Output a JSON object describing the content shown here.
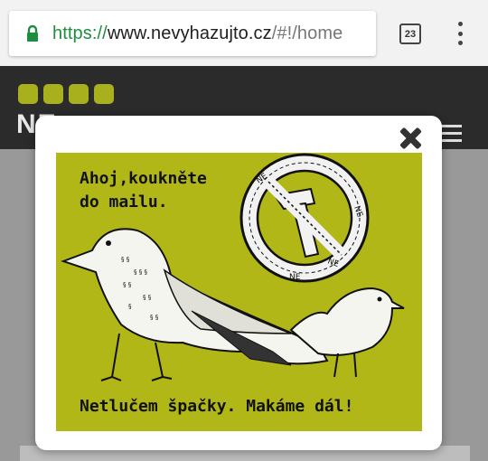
{
  "browser": {
    "url_scheme": "https://",
    "url_host": "www.nevyhazujto.cz",
    "url_path": "/#!/home",
    "tab_count": "23"
  },
  "site": {
    "logo_text": "NE"
  },
  "modal": {
    "line1": "Ahoj,koukněte",
    "line2": "do mailu.",
    "footer": "Netlučem špačky. Makáme dál!",
    "stamp_word": "NE"
  },
  "colors": {
    "promo_bg": "#b0b716",
    "header_bg": "#2b2b2b",
    "secure_green": "#1e8e3e"
  }
}
